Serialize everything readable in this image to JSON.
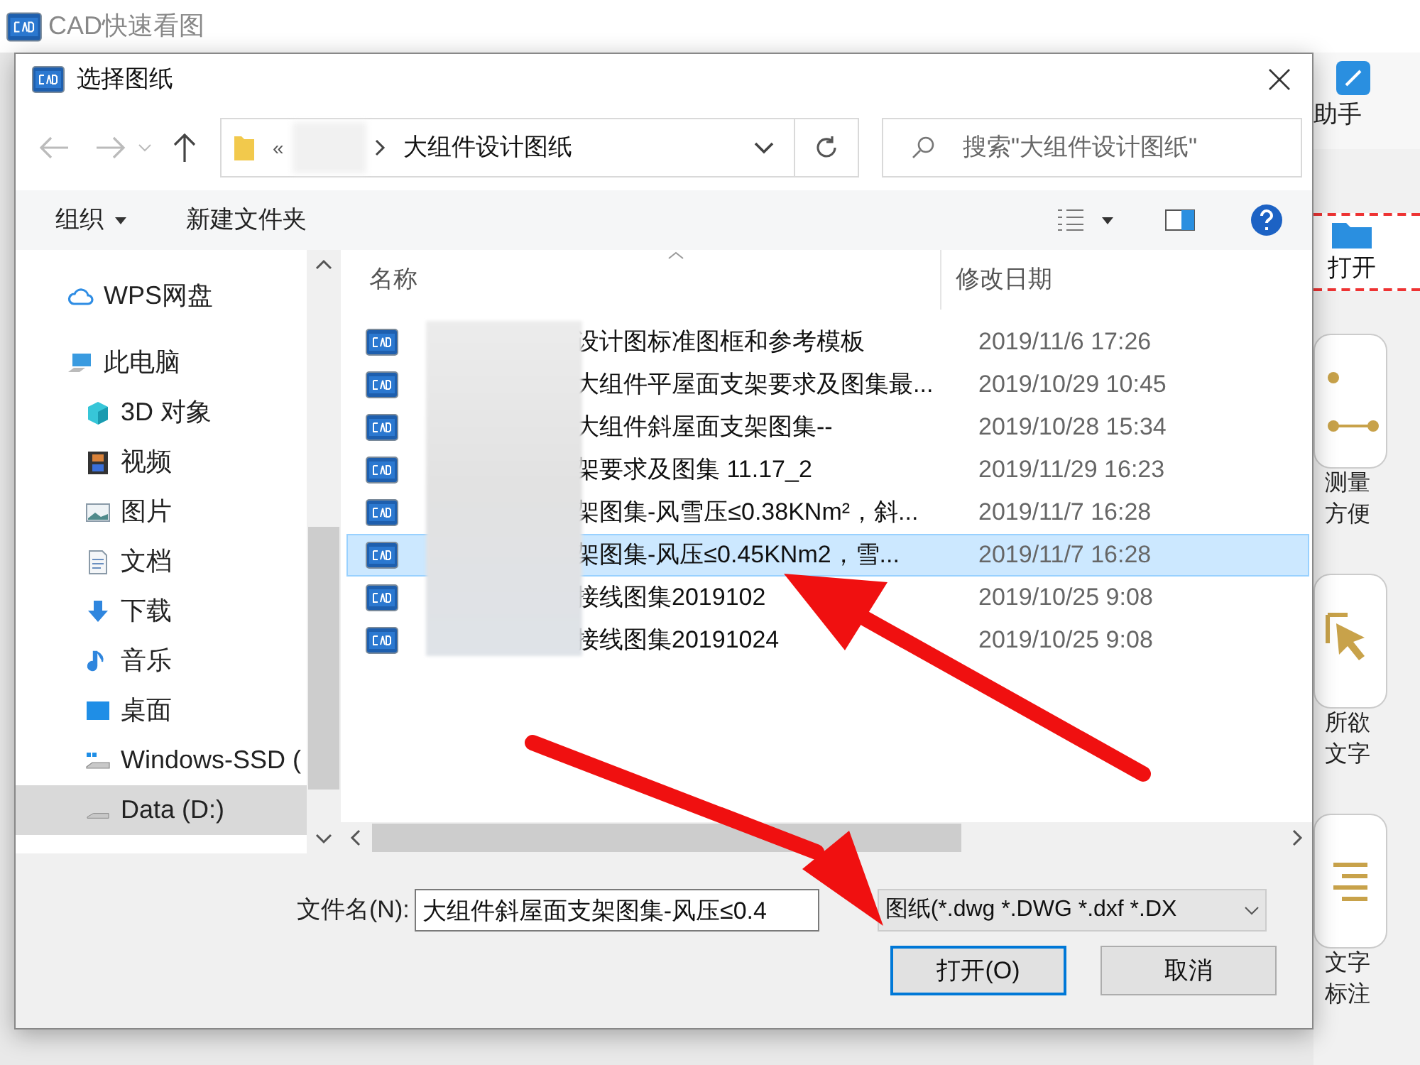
{
  "app": {
    "title": "CAD快速看图",
    "helper_label": "助手",
    "open_label": "打开",
    "cards": [
      {
        "lines": [
          "测量",
          "方便"
        ],
        "kind": "measure"
      },
      {
        "lines": [
          "所欲",
          "文字"
        ],
        "kind": "pointer"
      },
      {
        "lines": [
          "文字",
          "标注"
        ],
        "kind": "text"
      }
    ]
  },
  "dialog": {
    "title": "选择图纸",
    "address": {
      "prefix": "«",
      "folder": "大组件设计图纸"
    },
    "search": {
      "placeholder": "搜索\"大组件设计图纸\""
    },
    "toolbar": [
      {
        "label": "组织",
        "has_menu": true
      },
      {
        "label": "新建文件夹",
        "has_menu": false
      }
    ],
    "nav_items": [
      {
        "label": "WPS网盘",
        "kind": "cloud",
        "selected": false
      },
      {
        "label": "此电脑",
        "kind": "computer",
        "selected": false,
        "children": [
          {
            "label": "3D 对象",
            "kind": "cube",
            "selected": false
          },
          {
            "label": "视频",
            "kind": "film",
            "selected": false
          },
          {
            "label": "图片",
            "kind": "image",
            "selected": false
          },
          {
            "label": "文档",
            "kind": "document",
            "selected": false
          },
          {
            "label": "下载",
            "kind": "download",
            "selected": false
          },
          {
            "label": "音乐",
            "kind": "music",
            "selected": false
          },
          {
            "label": "桌面",
            "kind": "desktop",
            "selected": false
          },
          {
            "label": "Windows-SSD (",
            "kind": "system-drive",
            "selected": false
          },
          {
            "label": "Data (D:)",
            "kind": "drive",
            "selected": true
          }
        ]
      }
    ],
    "columns": [
      "名称",
      "修改日期"
    ],
    "files": [
      {
        "name": "设计图标准图框和参考模板",
        "date": "2019/11/6 17:26",
        "selected": false
      },
      {
        "name": "大组件平屋面支架要求及图集最...",
        "date": "2019/10/29 10:45",
        "selected": false
      },
      {
        "name": "大组件斜屋面支架图集--",
        "date": "2019/10/28 15:34",
        "selected": false
      },
      {
        "name": "架要求及图集 11.17_2",
        "date": "2019/11/29 16:23",
        "selected": false
      },
      {
        "name": "架图集-风雪压≤0.38KNm²，斜...",
        "date": "2019/11/7 16:28",
        "selected": false
      },
      {
        "name": "架图集-风压≤0.45KNm2，雪...",
        "date": "2019/11/7 16:28",
        "selected": true
      },
      {
        "name": "接线图集2019102",
        "date": "2019/10/25 9:08",
        "selected": false
      },
      {
        "name": "接线图集20191024",
        "date": "2019/10/25 9:08",
        "selected": false
      }
    ],
    "filename": {
      "label": "文件名(N):",
      "value": "大组件斜屋面支架图集-风压≤0.4"
    },
    "filetype": "图纸(*.dwg *.DWG *.dxf *.DX",
    "buttons": [
      {
        "label": "打开(O)",
        "default": true
      },
      {
        "label": "取消",
        "default": false
      }
    ]
  }
}
